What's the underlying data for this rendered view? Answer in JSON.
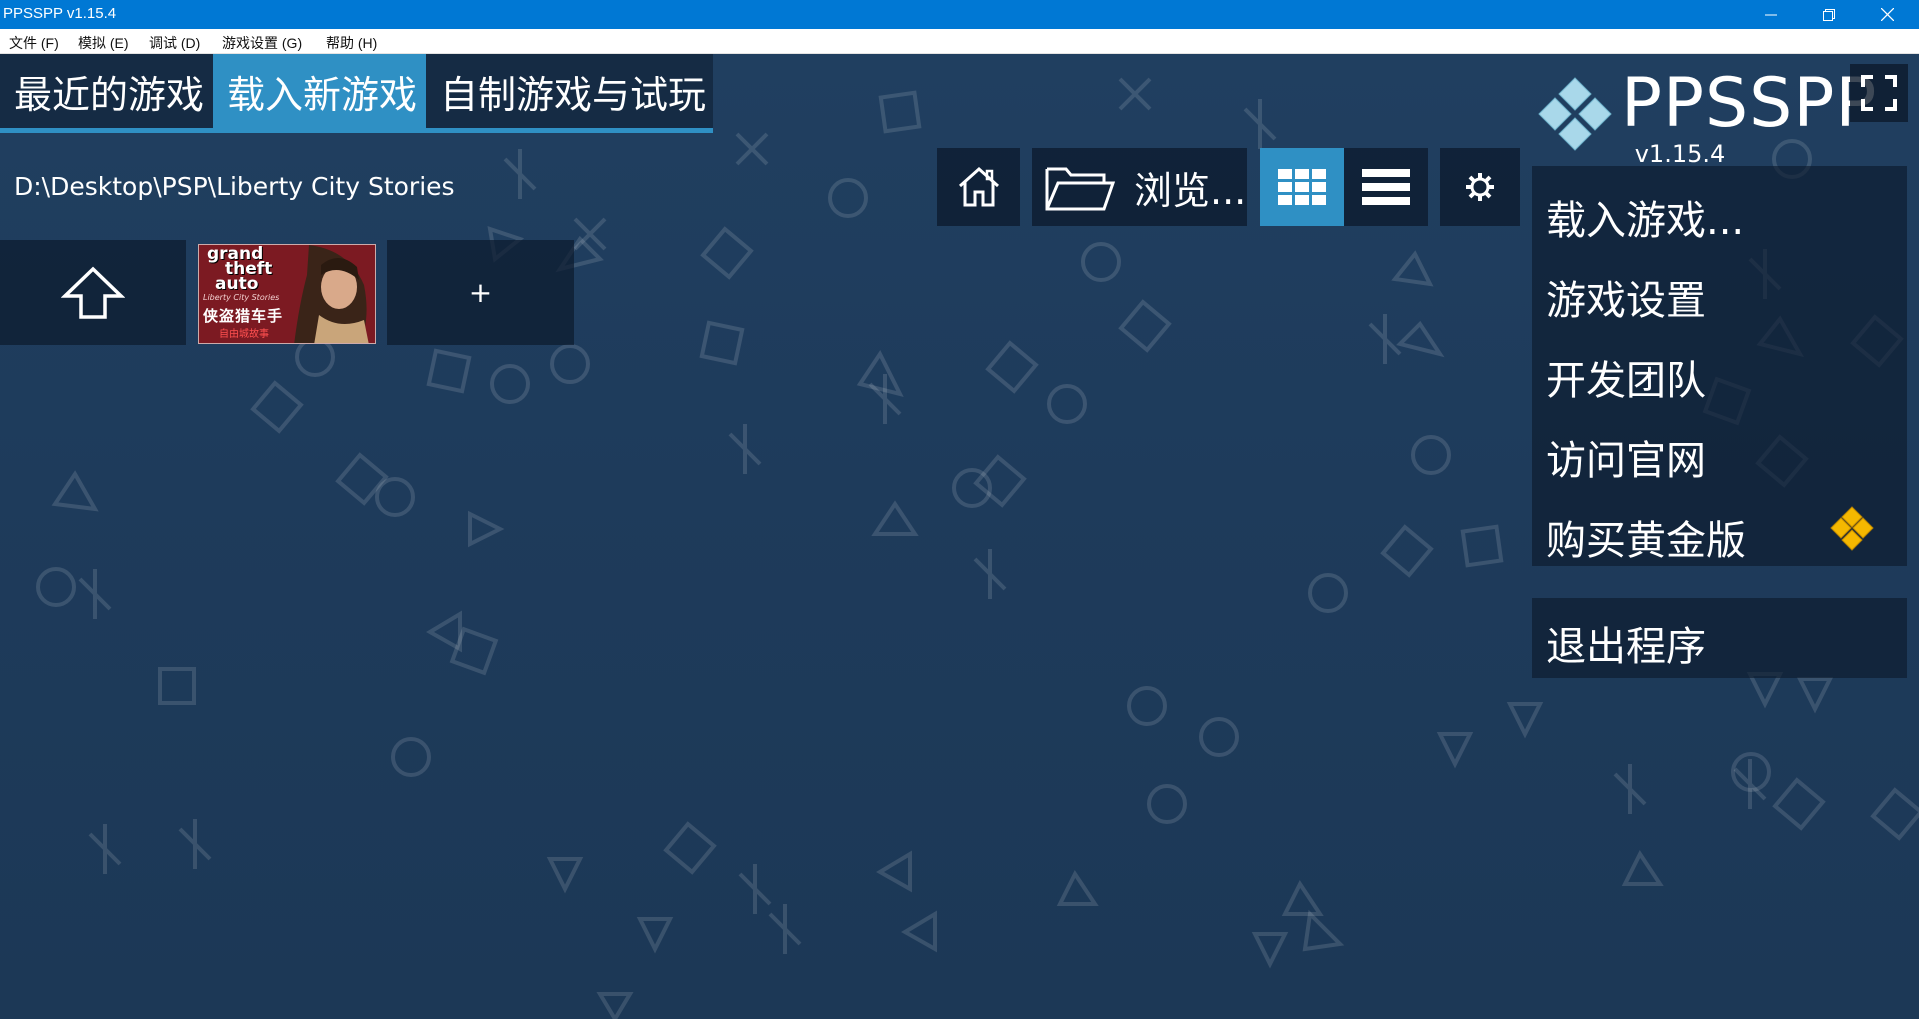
{
  "window": {
    "title": "PPSSPP v1.15.4"
  },
  "menu": {
    "items": [
      {
        "label": "文件 (F)"
      },
      {
        "label": "模拟 (E)"
      },
      {
        "label": "调试 (D)"
      },
      {
        "label": "游戏设置 (G)"
      },
      {
        "label": "帮助 (H)"
      }
    ]
  },
  "tabs": [
    {
      "label": "最近的游戏"
    },
    {
      "label": "载入新游戏",
      "active": true
    },
    {
      "label": "自制游戏与试玩"
    }
  ],
  "browser": {
    "path": "D:\\Desktop\\PSP\\Liberty City Stories",
    "browse_label": "浏览...",
    "view_mode": "grid",
    "add_label": "+"
  },
  "game": {
    "cover_lines": [
      "grand",
      "theft",
      "auto"
    ],
    "subtitle": "Liberty City Stories",
    "cn_title": "侠盗猎车手",
    "cn_subtitle": "自由城故事"
  },
  "brand": {
    "name": "PPSSPP",
    "version": "v1.15.4"
  },
  "side_menu": {
    "items": [
      {
        "label": "载入游戏..."
      },
      {
        "label": "游戏设置"
      },
      {
        "label": "开发团队"
      },
      {
        "label": "访问官网"
      },
      {
        "label": "购买黄金版"
      }
    ],
    "exit_label": "退出程序"
  },
  "colors": {
    "accent": "#2f90c4",
    "titlebar": "#0078d4",
    "gold": "#f5b800"
  },
  "icons": [
    "minimize-icon",
    "restore-icon",
    "close-icon",
    "home-icon",
    "folder-icon",
    "grid-view-icon",
    "list-view-icon",
    "gear-icon",
    "up-arrow-icon",
    "fullscreen-icon",
    "ppsspp-logo-icon",
    "gold-logo-icon"
  ]
}
